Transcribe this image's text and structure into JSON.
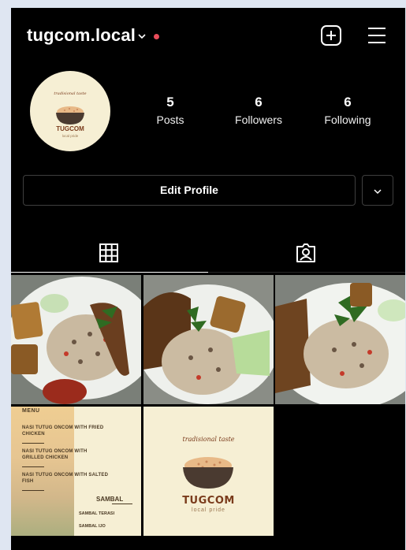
{
  "profile": {
    "username": "tugcom.local",
    "stats": [
      {
        "value": "5",
        "label": "Posts"
      },
      {
        "value": "6",
        "label": "Followers"
      },
      {
        "value": "6",
        "label": "Following"
      }
    ],
    "edit_label": "Edit Profile",
    "avatar": {
      "tagline": "tradisional taste",
      "name": "TUGCOM",
      "sub": "local pride"
    }
  },
  "colors": {
    "background": "#000000",
    "notification_dot": "#e84c5a",
    "card_cream": "#f6efd4",
    "brand_brown": "#7a3b1c"
  },
  "icons": {
    "chevron": "chevron-down-icon",
    "add": "new-post-icon",
    "menu": "hamburger-menu-icon",
    "grid_tab": "grid-icon",
    "tagged_tab": "tagged-person-icon"
  },
  "posts": {
    "menu_card": {
      "title": "MENU",
      "items": [
        "NASI TUTUG ONCOM WITH FRIED CHICKEN",
        "NASI TUTUG ONCOM WITH GRILLED CHICKEN",
        "NASI TUTUG ONCOM WITH SALTED FISH"
      ],
      "sambal_heading": "SAMBAL",
      "sambal_items": [
        "SAMBAL TERASI",
        "SAMBAL IJO"
      ]
    },
    "logo_card": {
      "tagline": "tradisional taste",
      "name": "TUGCOM",
      "sub": "local pride"
    }
  }
}
